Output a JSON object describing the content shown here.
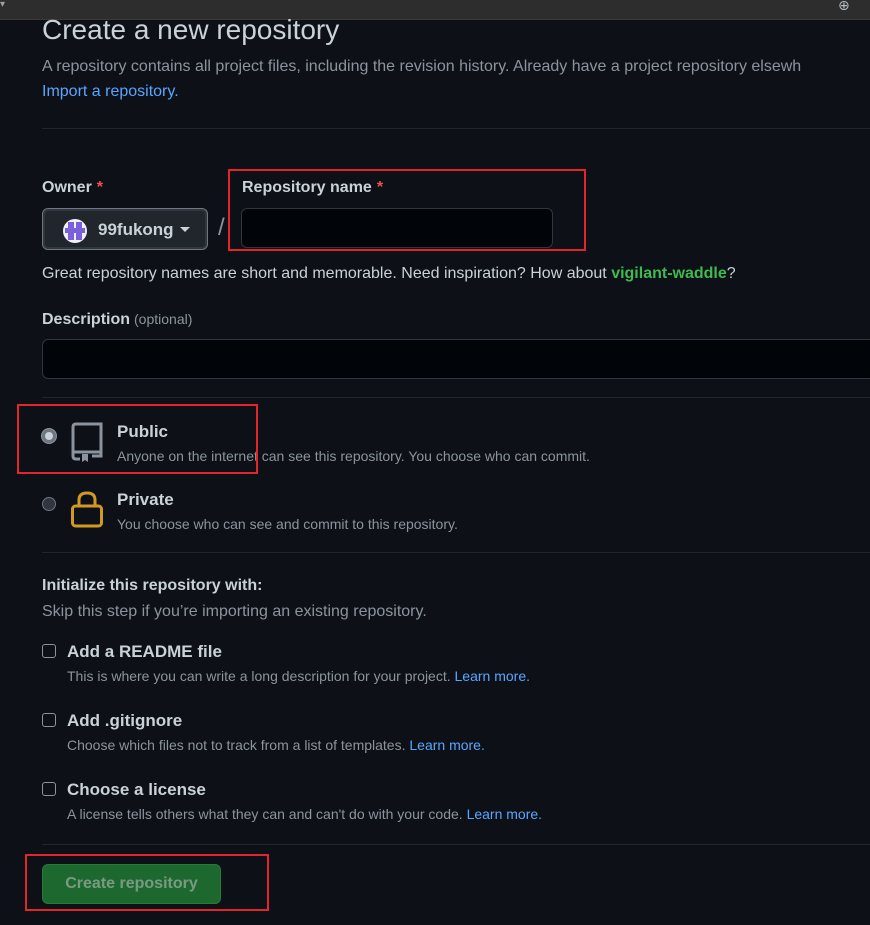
{
  "page": {
    "title": "Create a new repository",
    "subtitle": "A repository contains all project files, including the revision history. Already have a project repository elsewh",
    "import_link": "Import a repository."
  },
  "owner": {
    "label": "Owner",
    "required_mark": "*",
    "selected": "99fukong"
  },
  "repo_name": {
    "label": "Repository name",
    "required_mark": "*",
    "value": "",
    "placeholder": ""
  },
  "name_hint": {
    "text": "Great repository names are short and memorable. Need inspiration? How about ",
    "suggestion": "vigilant-waddle",
    "end": "?"
  },
  "description": {
    "label": "Description",
    "optional": "(optional)",
    "value": ""
  },
  "visibility": {
    "selected": "Public",
    "options": [
      {
        "title": "Public",
        "desc": "Anyone on the internet can see this repository. You choose who can commit.",
        "icon": "repo-icon"
      },
      {
        "title": "Private",
        "desc": "You choose who can see and commit to this repository.",
        "icon": "lock-icon"
      }
    ]
  },
  "initialize": {
    "title": "Initialize this repository with:",
    "subtitle": "Skip this step if you’re importing an existing repository.",
    "options": [
      {
        "title": "Add a README file",
        "desc": "This is where you can write a long description for your project. ",
        "link": "Learn more.",
        "checked": false
      },
      {
        "title": "Add .gitignore",
        "desc": "Choose which files not to track from a list of templates. ",
        "link": "Learn more.",
        "checked": false
      },
      {
        "title": "Choose a license",
        "desc": "A license tells others what they can and can't do with your code. ",
        "link": "Learn more.",
        "checked": false
      }
    ]
  },
  "submit": {
    "label": "Create repository"
  },
  "colors": {
    "background": "#0d1117",
    "link": "#58a6ff",
    "suggestion": "#3fb950",
    "required": "#f85149",
    "primary_button": "#238636",
    "highlight_box": "#e3242b",
    "lock_icon": "#d29922"
  }
}
